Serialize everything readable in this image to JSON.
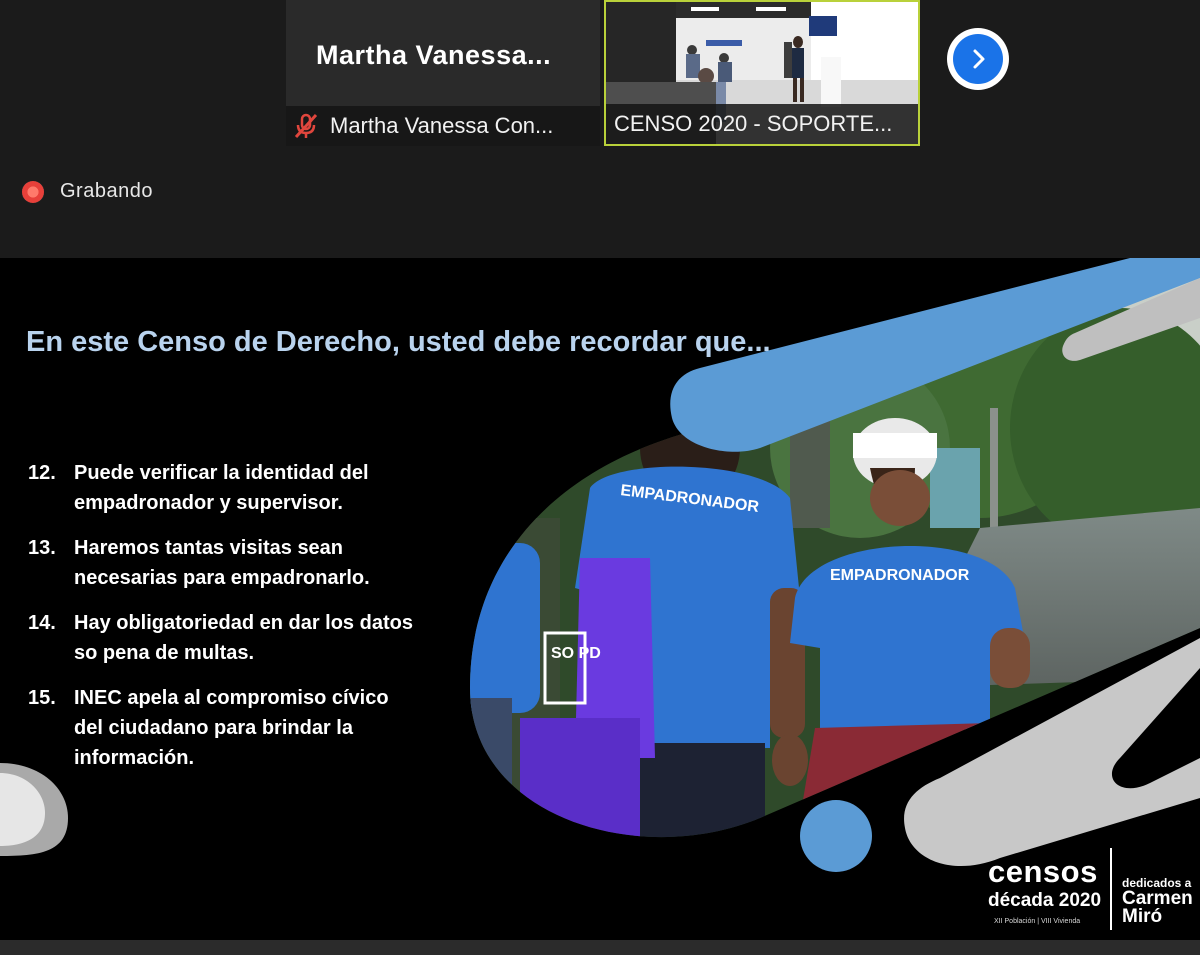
{
  "participants": [
    {
      "display_name": "Martha  Vanessa...",
      "label": "Martha Vanessa Con...",
      "muted": true
    },
    {
      "label": "CENSO 2020 - SOPORTE..."
    }
  ],
  "recording": {
    "label": "Grabando"
  },
  "slide": {
    "title": "En este Censo de Derecho, usted debe recordar que...",
    "points": [
      {
        "number": "12.",
        "lines": [
          "Puede verificar la identidad del",
          "empadronador y supervisor."
        ]
      },
      {
        "number": "13.",
        "lines": [
          "Haremos tantas visitas sean",
          "necesarias para empadronarlo."
        ]
      },
      {
        "number": "14.",
        "lines": [
          "Hay obligatoriedad en dar los datos",
          "so pena de multas."
        ]
      },
      {
        "number": "15.",
        "lines": [
          "INEC apela al compromiso cívico",
          "del ciudadano para brindar la",
          "información."
        ]
      }
    ],
    "shirt_text": "EMPADRONADOR",
    "bag_text": "SO PD",
    "brand": {
      "name": "censos",
      "decade": "década 2020",
      "subtitle": "XII Población | VIII Vivienda",
      "dedication": "dedicados a",
      "name_line1": "Carmen",
      "name_line2": "Miró"
    }
  },
  "colors": {
    "accent_blue": "#5b9bd5",
    "shirt_blue": "#2f74d0",
    "title": "#b9d3ee",
    "active_border": "#b9d13a",
    "next_button": "#1a73e8"
  },
  "icons": {
    "mute": "mic-muted-icon",
    "next": "chevron-right-icon",
    "recording": "record-dot-icon"
  }
}
